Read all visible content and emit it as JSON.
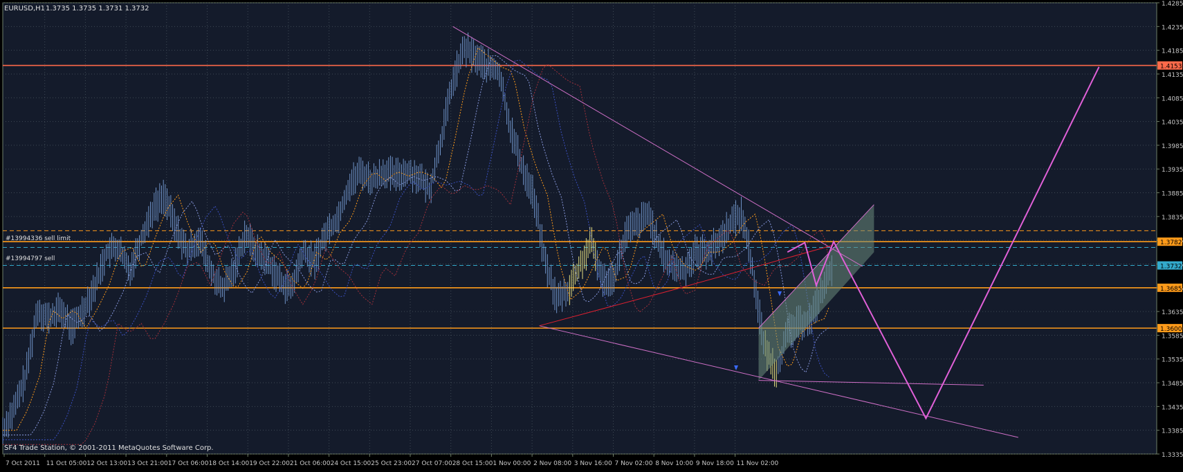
{
  "header": {
    "symbol": "EURUSD,H1",
    "ohlc": "1.3735 1.3735 1.3731 1.3732"
  },
  "footer": {
    "copyright": "SF4 Trade Station, © 2001-2011 MetaQuotes Software Corp."
  },
  "colors": {
    "background": "#000000",
    "plot_background": "#141b2b",
    "frame": "#6f7f6a",
    "grid": "#3f4a55",
    "axis_text": "#c8c8c8",
    "candle": "#6f93c8",
    "candle_highlight": "#e8e080",
    "orange_level": "#ff9b1a",
    "red_level": "#ff6a4a",
    "cyan_level": "#33aacc",
    "magenta": "#e060d8",
    "pink_thin": "#d070c8",
    "red_line": "#e02030",
    "yellow_ma": "#ffd86a",
    "channel_fill": "#6a8a7c"
  },
  "chart_data": {
    "type": "line",
    "title": "EURUSD,H1",
    "ylim": [
      1.3335,
      1.4285
    ],
    "y_ticks": [
      "1.4285",
      "1.4235",
      "1.4185",
      "1.4135",
      "1.4085",
      "1.4035",
      "1.3985",
      "1.3935",
      "1.3885",
      "1.3835",
      "1.3785",
      "1.3735",
      "1.3685",
      "1.3635",
      "1.3585",
      "1.3535",
      "1.3485",
      "1.3435",
      "1.3385",
      "1.3335"
    ],
    "x_ticks": [
      "7 Oct 2011",
      "11 Oct 05:00",
      "12 Oct 13:00",
      "13 Oct 21:00",
      "17 Oct 06:00",
      "18 Oct 14:00",
      "19 Oct 22:00",
      "21 Oct 06:00",
      "24 Oct 15:00",
      "25 Oct 23:00",
      "27 Oct 07:00",
      "28 Oct 15:00",
      "1 Nov 00:00",
      "2 Nov 08:00",
      "3 Nov 16:00",
      "7 Nov 02:00",
      "8 Nov 10:00",
      "9 Nov 18:00",
      "11 Nov 02:00"
    ],
    "grid": true,
    "price_labels": [
      {
        "value": 1.4153,
        "label": "1.4153",
        "color": "#ff6a4a"
      },
      {
        "value": 1.3782,
        "label": "1.3782",
        "color": "#ff9b1a"
      },
      {
        "value": 1.3732,
        "label": "1.3732",
        "color": "#33aacc"
      },
      {
        "value": 1.3685,
        "label": "1.3685",
        "color": "#ff9b1a"
      },
      {
        "value": 1.36,
        "label": "1.3600",
        "color": "#ff9b1a"
      }
    ],
    "orders": [
      {
        "label": "#13994336 sell limit",
        "value": 1.3782
      },
      {
        "label": "#13994797 sell",
        "value": 1.374
      }
    ],
    "levels": [
      {
        "value": 1.4153,
        "style": "solid",
        "color": "#ff6a4a"
      },
      {
        "value": 1.3782,
        "style": "solid",
        "color": "#ff9b1a"
      },
      {
        "value": 1.3685,
        "style": "solid",
        "color": "#ff9b1a"
      },
      {
        "value": 1.36,
        "style": "solid",
        "color": "#ff9b1a"
      },
      {
        "value": 1.3805,
        "style": "dash",
        "color": "#ff9b1a"
      },
      {
        "value": 1.377,
        "style": "dash",
        "color": "#33aacc"
      },
      {
        "value": 1.3732,
        "style": "dash",
        "color": "#33aacc"
      }
    ],
    "series": [
      {
        "values": [
          [
            0.0,
            1.3385
          ],
          [
            0.01,
            1.343
          ],
          [
            0.02,
            1.35
          ],
          [
            0.03,
            1.364
          ],
          [
            0.04,
            1.362
          ],
          [
            0.05,
            1.364
          ],
          [
            0.06,
            1.36
          ],
          [
            0.07,
            1.364
          ],
          [
            0.08,
            1.369
          ],
          [
            0.09,
            1.376
          ],
          [
            0.1,
            1.377
          ],
          [
            0.11,
            1.372
          ],
          [
            0.12,
            1.379
          ],
          [
            0.13,
            1.385
          ],
          [
            0.14,
            1.388
          ],
          [
            0.15,
            1.381
          ],
          [
            0.16,
            1.376
          ],
          [
            0.17,
            1.379
          ],
          [
            0.18,
            1.372
          ],
          [
            0.19,
            1.368
          ],
          [
            0.2,
            1.372
          ],
          [
            0.21,
            1.38
          ],
          [
            0.22,
            1.376
          ],
          [
            0.23,
            1.374
          ],
          [
            0.24,
            1.37
          ],
          [
            0.25,
            1.368
          ],
          [
            0.26,
            1.376
          ],
          [
            0.27,
            1.374
          ],
          [
            0.28,
            1.38
          ],
          [
            0.29,
            1.383
          ],
          [
            0.3,
            1.39
          ],
          [
            0.31,
            1.393
          ],
          [
            0.32,
            1.391
          ],
          [
            0.33,
            1.393
          ],
          [
            0.34,
            1.392
          ],
          [
            0.35,
            1.393
          ],
          [
            0.36,
            1.392
          ],
          [
            0.37,
            1.389
          ],
          [
            0.38,
            1.4
          ],
          [
            0.39,
            1.412
          ],
          [
            0.4,
            1.419
          ],
          [
            0.41,
            1.417
          ],
          [
            0.42,
            1.415
          ],
          [
            0.43,
            1.414
          ],
          [
            0.44,
            1.402
          ],
          [
            0.45,
            1.394
          ],
          [
            0.46,
            1.388
          ],
          [
            0.47,
            1.374
          ],
          [
            0.48,
            1.366
          ],
          [
            0.49,
            1.368
          ],
          [
            0.5,
            1.373
          ],
          [
            0.51,
            1.378
          ],
          [
            0.52,
            1.37
          ],
          [
            0.53,
            1.371
          ],
          [
            0.54,
            1.38
          ],
          [
            0.55,
            1.382
          ],
          [
            0.56,
            1.384
          ],
          [
            0.57,
            1.376
          ],
          [
            0.58,
            1.373
          ],
          [
            0.59,
            1.372
          ],
          [
            0.6,
            1.376
          ],
          [
            0.61,
            1.376
          ],
          [
            0.62,
            1.378
          ],
          [
            0.63,
            1.382
          ],
          [
            0.64,
            1.384
          ],
          [
            0.645,
            1.379
          ],
          [
            0.65,
            1.372
          ],
          [
            0.66,
            1.356
          ],
          [
            0.67,
            1.351
          ],
          [
            0.675,
            1.3545
          ],
          [
            0.68,
            1.359
          ],
          [
            0.69,
            1.361
          ],
          [
            0.7,
            1.362
          ],
          [
            0.71,
            1.368
          ],
          [
            0.72,
            1.3732
          ]
        ]
      }
    ],
    "annotations": {
      "resistance_trendline": [
        [
          0.39,
          1.4235
        ],
        [
          0.745,
          1.373
        ]
      ],
      "support_trendline": [
        [
          0.465,
          1.3605
        ],
        [
          0.88,
          1.337
        ]
      ],
      "red_trendline_1": [
        [
          0.465,
          1.3605
        ],
        [
          0.58,
          1.368
        ]
      ],
      "red_trendline_2": [
        [
          0.58,
          1.368
        ],
        [
          0.72,
          1.3775
        ]
      ],
      "channel_upper": [
        [
          0.655,
          1.36
        ],
        [
          0.755,
          1.386
        ]
      ],
      "channel_lower": [
        [
          0.655,
          1.349
        ],
        [
          0.85,
          1.348
        ]
      ],
      "projection_zigzag": [
        [
          0.68,
          1.376
        ],
        [
          0.695,
          1.378
        ],
        [
          0.705,
          1.369
        ],
        [
          0.72,
          1.3782
        ],
        [
          0.8,
          1.341
        ],
        [
          0.95,
          1.415
        ]
      ]
    }
  }
}
